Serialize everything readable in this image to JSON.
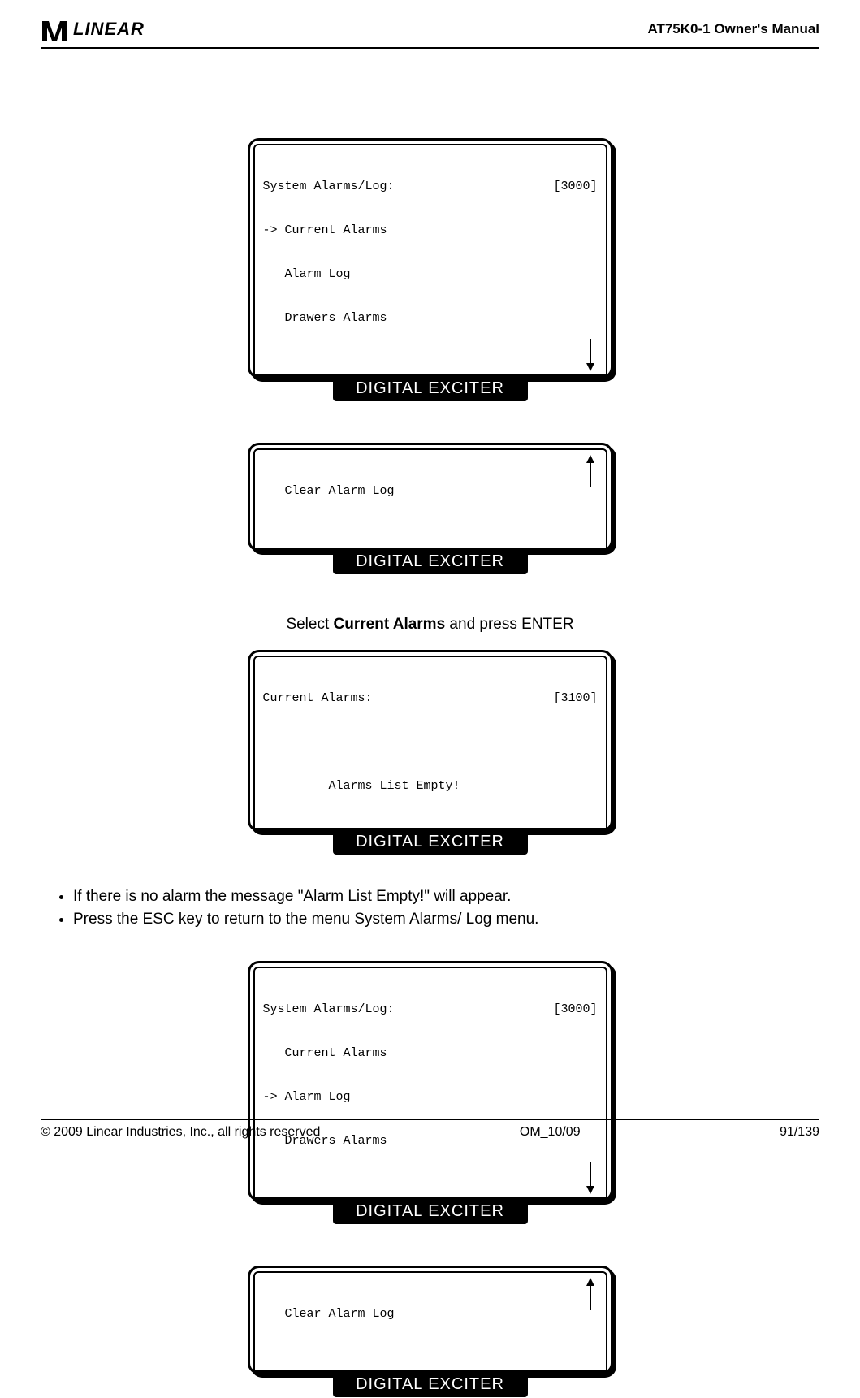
{
  "header": {
    "logo_text": "LINEAR",
    "title": "AT75K0-1 Owner's Manual"
  },
  "screens": {
    "s1": {
      "title": "System Alarms/Log:",
      "code": "[3000]",
      "line2": "-> Current Alarms",
      "line3": "   Alarm Log",
      "line4": "   Drawers Alarms",
      "label": "DIGITAL EXCITER"
    },
    "s2": {
      "line1": "   Clear Alarm Log",
      "label": "DIGITAL EXCITER"
    },
    "s3": {
      "title": "Current Alarms:",
      "code": "[3100]",
      "line3": "         Alarms List Empty!",
      "label": "DIGITAL EXCITER"
    },
    "s4": {
      "title": "System Alarms/Log:",
      "code": "[3000]",
      "line2": "   Current Alarms",
      "line3": "-> Alarm Log",
      "line4": "   Drawers Alarms",
      "label": "DIGITAL EXCITER"
    },
    "s5": {
      "line1": "   Clear Alarm Log",
      "label": "DIGITAL EXCITER"
    }
  },
  "instruction": {
    "prefix": "Select ",
    "bold": "Current Alarms",
    "suffix": " and press ENTER"
  },
  "bullets": {
    "b1": "If there is no alarm the message \"Alarm List Empty!\" will appear.",
    "b2": "Press the ESC key to return to the menu System Alarms/ Log menu."
  },
  "footer": {
    "left": "© 2009 Linear Industries, Inc., all rights reserved",
    "center": "OM_10/09",
    "right": "91/139"
  }
}
